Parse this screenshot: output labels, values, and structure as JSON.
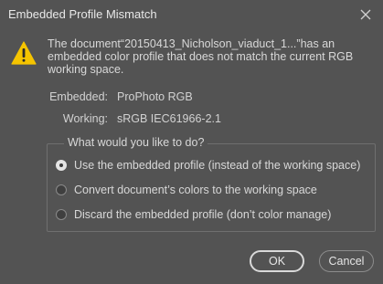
{
  "window": {
    "title": "Embedded Profile Mismatch"
  },
  "message": {
    "text": "The document“20150413_Nicholson_viaduct_1...”has an embedded color profile that does not match the current RGB working space."
  },
  "profiles": {
    "embedded_label": "Embedded:",
    "embedded_value": "ProPhoto RGB",
    "working_label": "Working:",
    "working_value": "sRGB IEC61966-2.1"
  },
  "options": {
    "legend": "What would you like to do?",
    "items": [
      {
        "label": "Use the embedded profile (instead of the working space)",
        "selected": true
      },
      {
        "label": "Convert document’s colors to the working space",
        "selected": false
      },
      {
        "label": "Discard the embedded profile (don’t color manage)",
        "selected": false
      }
    ]
  },
  "buttons": {
    "ok_label": "OK",
    "cancel_label": "Cancel"
  },
  "icons": {
    "warning": "warning-triangle-icon",
    "close": "close-icon"
  },
  "colors": {
    "background": "#535353",
    "warning_fill": "#f5c400",
    "text": "#d8d8d8"
  }
}
